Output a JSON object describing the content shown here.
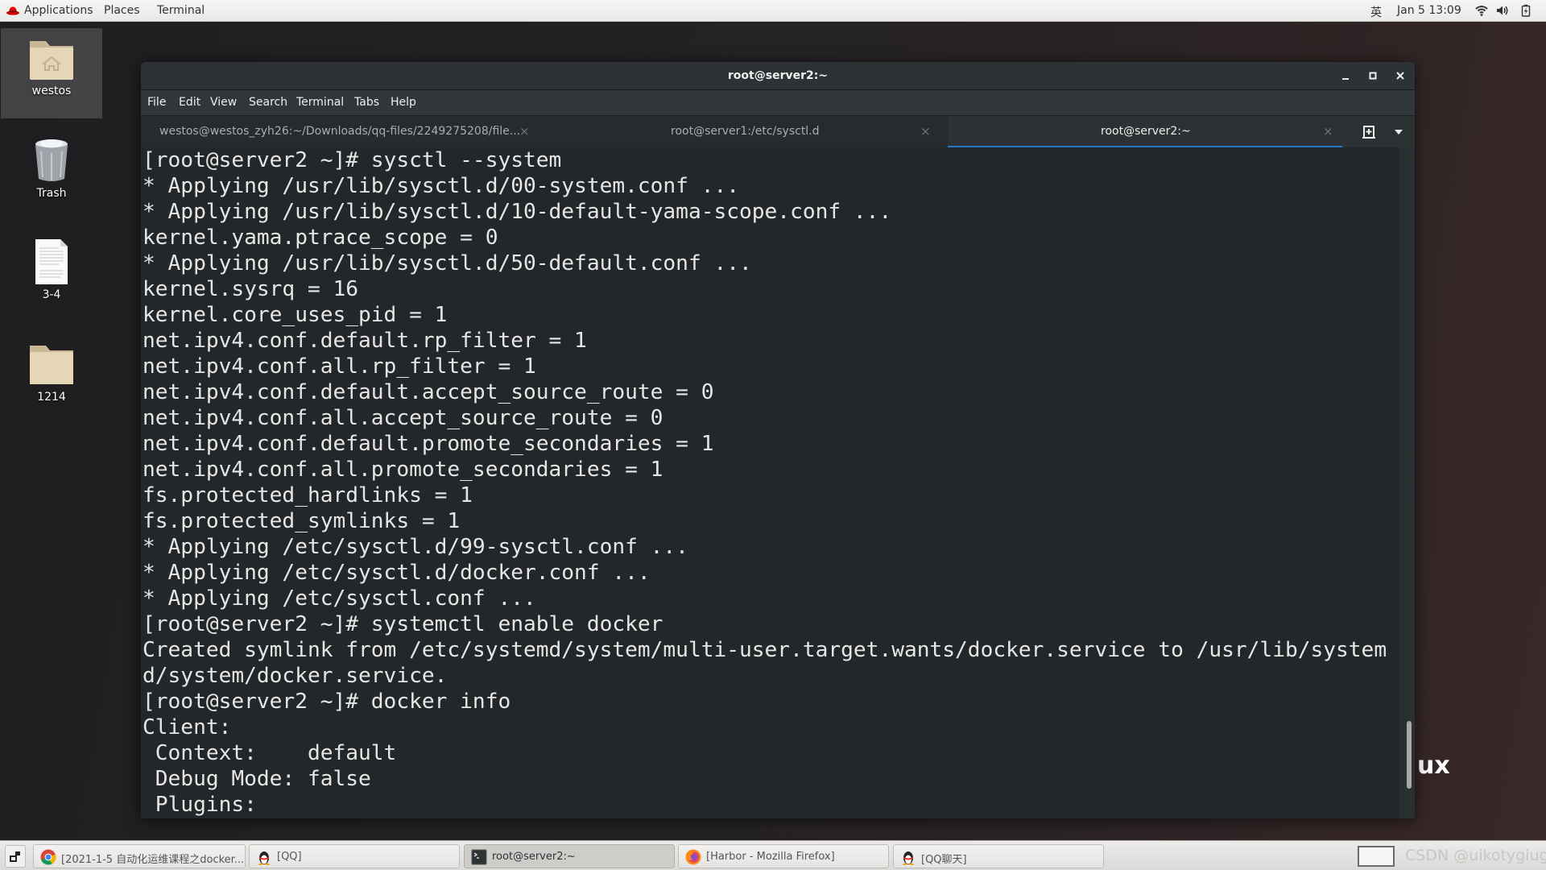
{
  "topbar": {
    "menus": [
      "Applications",
      "Places",
      "Terminal"
    ],
    "input_method": "英",
    "datetime": "Jan 5  13:09",
    "tray_icons": [
      "wifi-icon",
      "volume-icon",
      "battery-icon"
    ]
  },
  "desktop": {
    "icons": [
      {
        "label": "westos",
        "icon": "home-folder-icon",
        "selected": true
      },
      {
        "label": "Trash",
        "icon": "trash-icon",
        "selected": false
      },
      {
        "label": "3-4",
        "icon": "text-document-icon",
        "selected": false
      },
      {
        "label": "1214",
        "icon": "folder-icon",
        "selected": false
      }
    ],
    "background_text": "ux"
  },
  "window": {
    "title": "root@server2:~",
    "controls": [
      "minimize",
      "maximize",
      "close"
    ],
    "menu": [
      "File",
      "Edit",
      "View",
      "Search",
      "Terminal",
      "Tabs",
      "Help"
    ],
    "tabs": [
      {
        "label": "westos@westos_zyh26:~/Downloads/qq-files/2249275208/file...",
        "active": false
      },
      {
        "label": "root@server1:/etc/sysctl.d",
        "active": false
      },
      {
        "label": "root@server2:~",
        "active": true
      }
    ],
    "tab_close_glyph": "×",
    "accent_color": "#2a76c6"
  },
  "terminal": {
    "lines": [
      "[root@server2 ~]# sysctl --system",
      "* Applying /usr/lib/sysctl.d/00-system.conf ...",
      "* Applying /usr/lib/sysctl.d/10-default-yama-scope.conf ...",
      "kernel.yama.ptrace_scope = 0",
      "* Applying /usr/lib/sysctl.d/50-default.conf ...",
      "kernel.sysrq = 16",
      "kernel.core_uses_pid = 1",
      "net.ipv4.conf.default.rp_filter = 1",
      "net.ipv4.conf.all.rp_filter = 1",
      "net.ipv4.conf.default.accept_source_route = 0",
      "net.ipv4.conf.all.accept_source_route = 0",
      "net.ipv4.conf.default.promote_secondaries = 1",
      "net.ipv4.conf.all.promote_secondaries = 1",
      "fs.protected_hardlinks = 1",
      "fs.protected_symlinks = 1",
      "* Applying /etc/sysctl.d/99-sysctl.conf ...",
      "* Applying /etc/sysctl.d/docker.conf ...",
      "* Applying /etc/sysctl.conf ...",
      "[root@server2 ~]# systemctl enable docker",
      "Created symlink from /etc/systemd/system/multi-user.target.wants/docker.service to /usr/lib/system",
      "d/system/docker.service.",
      "[root@server2 ~]# docker info",
      "Client:",
      " Context:    default",
      " Debug Mode: false",
      " Plugins:"
    ]
  },
  "taskbar": {
    "items": [
      {
        "label": "[2021-1-5 自动化运维课程之docker...",
        "icon": "chrome-icon",
        "active": false
      },
      {
        "label": "[QQ]",
        "icon": "qq-penguin-icon",
        "active": false
      },
      {
        "label": "root@server2:~",
        "icon": "terminal-icon",
        "active": true
      },
      {
        "label": "[Harbor - Mozilla Firefox]",
        "icon": "firefox-icon",
        "active": false
      },
      {
        "label": "[QQ聊天]",
        "icon": "qq-penguin-icon",
        "active": false
      }
    ],
    "watermark": "CSDN @uikotygiug"
  }
}
